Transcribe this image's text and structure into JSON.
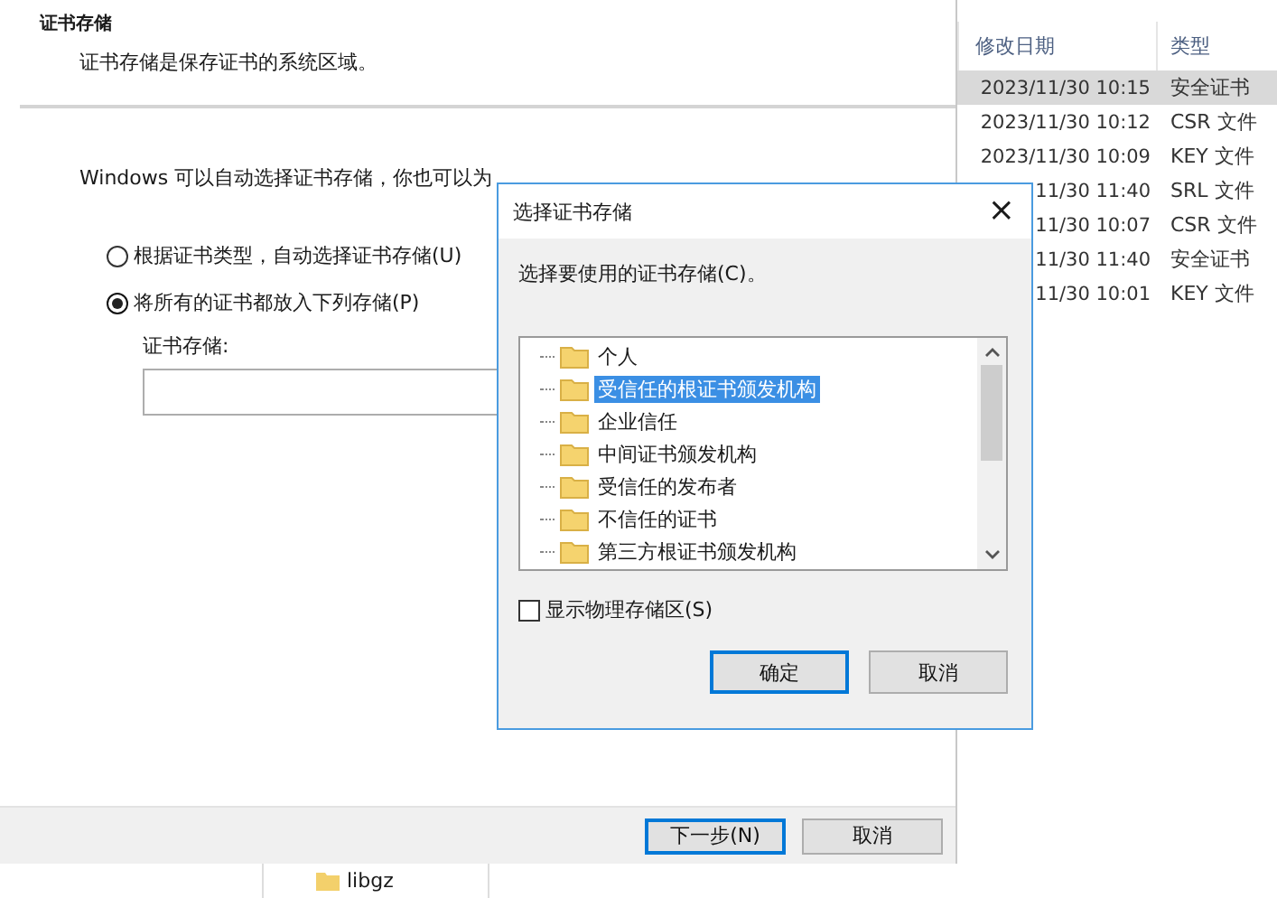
{
  "wizard": {
    "section_title": "证书存储",
    "section_description": "证书存储是保存证书的系统区域。",
    "intro": "Windows 可以自动选择证书存储，你也可以为",
    "options": [
      {
        "label": "根据证书类型，自动选择证书存储(U)",
        "selected": false
      },
      {
        "label": "将所有的证书都放入下列存储(P)",
        "selected": true
      }
    ],
    "store_label": "证书存储:",
    "buttons": [
      {
        "label": "下一步(N)",
        "kind": "default"
      },
      {
        "label": "取消",
        "kind": "normal"
      }
    ]
  },
  "explorer": {
    "columns": [
      "修改日期",
      "类型"
    ],
    "rows": [
      {
        "date": "2023/11/30 10:15",
        "type": "安全证书",
        "selected": true
      },
      {
        "date": "2023/11/30 10:12",
        "type": "CSR 文件",
        "selected": false
      },
      {
        "date": "2023/11/30 10:09",
        "type": "KEY 文件",
        "selected": false
      },
      {
        "date": "11/30 11:40",
        "type": "SRL 文件",
        "selected": false
      },
      {
        "date": "11/30 10:07",
        "type": "CSR 文件",
        "selected": false
      },
      {
        "date": "11/30 11:40",
        "type": "安全证书",
        "selected": false
      },
      {
        "date": "11/30 10:01",
        "type": "KEY 文件",
        "selected": false
      }
    ],
    "nav_item": "libgz"
  },
  "dialog": {
    "title": "选择证书存储",
    "close": "×",
    "prompt": "选择要使用的证书存储(C)。",
    "stores": [
      {
        "label": "个人",
        "selected": false
      },
      {
        "label": "受信任的根证书颁发机构",
        "selected": true
      },
      {
        "label": "企业信任",
        "selected": false
      },
      {
        "label": "中间证书颁发机构",
        "selected": false
      },
      {
        "label": "受信任的发布者",
        "selected": false
      },
      {
        "label": "不信任的证书",
        "selected": false
      },
      {
        "label": "第三方根证书颁发机构",
        "selected": false
      }
    ],
    "show_physical": {
      "label": "显示物理存储区(S)",
      "checked": false
    },
    "buttons": [
      {
        "label": "确定",
        "kind": "default"
      },
      {
        "label": "取消",
        "kind": "normal"
      }
    ]
  }
}
